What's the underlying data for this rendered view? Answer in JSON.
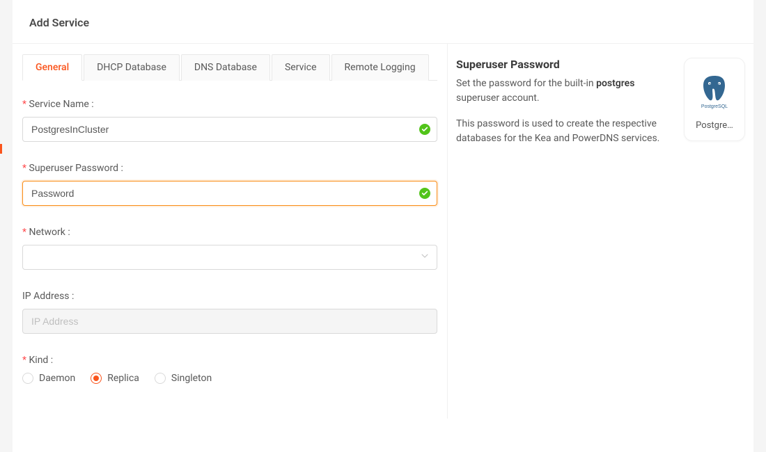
{
  "header": {
    "title": "Add Service"
  },
  "tabs": [
    {
      "label": "General",
      "active": true
    },
    {
      "label": "DHCP Database",
      "active": false
    },
    {
      "label": "DNS Database",
      "active": false
    },
    {
      "label": "Service",
      "active": false
    },
    {
      "label": "Remote Logging",
      "active": false
    }
  ],
  "form": {
    "service_name": {
      "label": "Service Name :",
      "value": "PostgresInCluster",
      "required": true,
      "valid": true
    },
    "superuser_password": {
      "label": "Superuser Password :",
      "value": "Password",
      "required": true,
      "valid": true,
      "focused": true
    },
    "network": {
      "label": "Network :",
      "value": "",
      "required": true
    },
    "ip_address": {
      "label": "IP Address :",
      "placeholder": "IP Address",
      "value": "",
      "required": false,
      "disabled": true
    },
    "kind": {
      "label": "Kind :",
      "required": true,
      "options": [
        {
          "label": "Daemon",
          "value": "daemon"
        },
        {
          "label": "Replica",
          "value": "replica"
        },
        {
          "label": "Singleton",
          "value": "singleton"
        }
      ],
      "selected": "replica"
    }
  },
  "help": {
    "title": "Superuser Password",
    "line1_pre": "Set the password for the built-in ",
    "line1_bold": "postgres",
    "line1_post": " superuser account.",
    "line2": "This password is used to create the respective databases for the Kea and PowerDNS services."
  },
  "service_card": {
    "logo_name": "postgresql-logo",
    "label": "Postgre…"
  },
  "colors": {
    "accent": "#fa541c",
    "success": "#52c41a"
  }
}
